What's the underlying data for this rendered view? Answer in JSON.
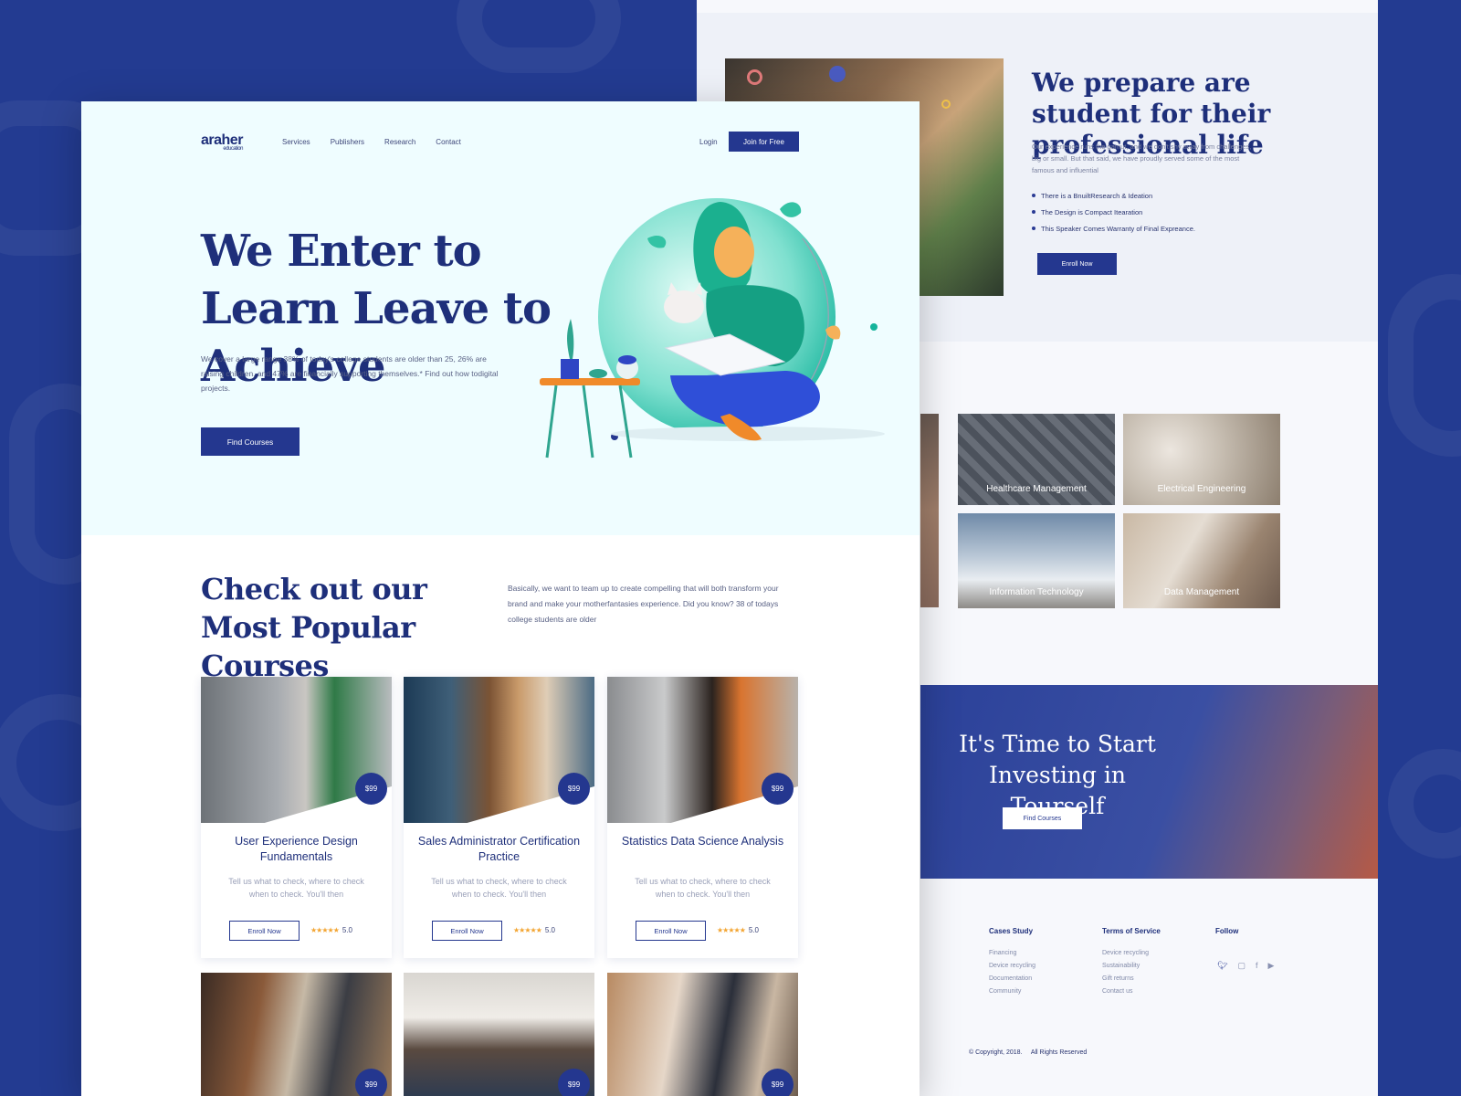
{
  "front": {
    "brand": {
      "name": "araher",
      "sub": "education"
    },
    "nav": [
      "Services",
      "Publishers",
      "Research",
      "Contact"
    ],
    "login": "Login",
    "join": "Join for Free",
    "hero": {
      "title": "We Enter to Learn Leave to Achieve",
      "text": "We cover a large range 38% of today's college students are older than 25, 26% are raising children, and 47% are financially supporting themselves.* Find out how todigital projects.",
      "button": "Find Courses"
    },
    "courses_section": {
      "title": "Check out our Most Popular Courses",
      "text": "Basically, we want to team up to create compelling that will both transform your brand and make your motherfantasies experience. Did you know? 38 of todays college students are older"
    },
    "courses": [
      {
        "price": "$99",
        "title": "User Experience Design Fundamentals",
        "desc": "Tell us what to check, where to check when to check. You'll then",
        "enroll": "Enroll Now",
        "stars": "★★★★★",
        "rating": "5.0"
      },
      {
        "price": "$99",
        "title": "Sales Administrator Certification Practice",
        "desc": "Tell us what to check, where to check when to check. You'll then",
        "enroll": "Enroll Now",
        "stars": "★★★★★",
        "rating": "5.0"
      },
      {
        "price": "$99",
        "title": "Statistics Data Science Analysis",
        "desc": "Tell us what to check, where to check when to check. You'll then",
        "enroll": "Enroll Now",
        "stars": "★★★★★",
        "rating": "5.0"
      }
    ],
    "courses_row2": [
      {
        "price": "$99"
      },
      {
        "price": "$99"
      },
      {
        "price": "$99"
      }
    ]
  },
  "back": {
    "about": {
      "title": "We prepare are student for their professional life",
      "text": "Our experience runs the gamut, and we don't shy away from challenges, big or small. But that said, we have proudly served some of the most famous and influential",
      "bullets": [
        "There is a BnuiltResearch & Ideation",
        "The Design is Compact Itearation",
        "This Speaker Comes Warranty of Final Expreance."
      ],
      "button": "Enroll Now"
    },
    "categories": [
      "Healthcare Management",
      "Electrical Engineering",
      "Information Technology",
      "Data Management"
    ],
    "cta": {
      "title": "It's Time to Start Investing in Tourself",
      "button": "Find Courses"
    },
    "footer": {
      "cases_title": "Cases Study",
      "cases": [
        "Financing",
        "Device recycling",
        "Documentation",
        "Community"
      ],
      "terms_title": "Terms of Service",
      "terms": [
        "Device recycling",
        "Sustainability",
        "Gift returns",
        "Contact us"
      ],
      "follow_title": "Follow",
      "social": [
        "twitter-icon",
        "instagram-icon",
        "facebook-icon",
        "youtube-icon"
      ],
      "copyright": "© Copyright, 2018.",
      "rights": "All Rights Reserved"
    }
  },
  "colors": {
    "primary": "#24378f",
    "background": "#233b91",
    "hero_bg": "#effdff",
    "star": "#f3a532"
  }
}
